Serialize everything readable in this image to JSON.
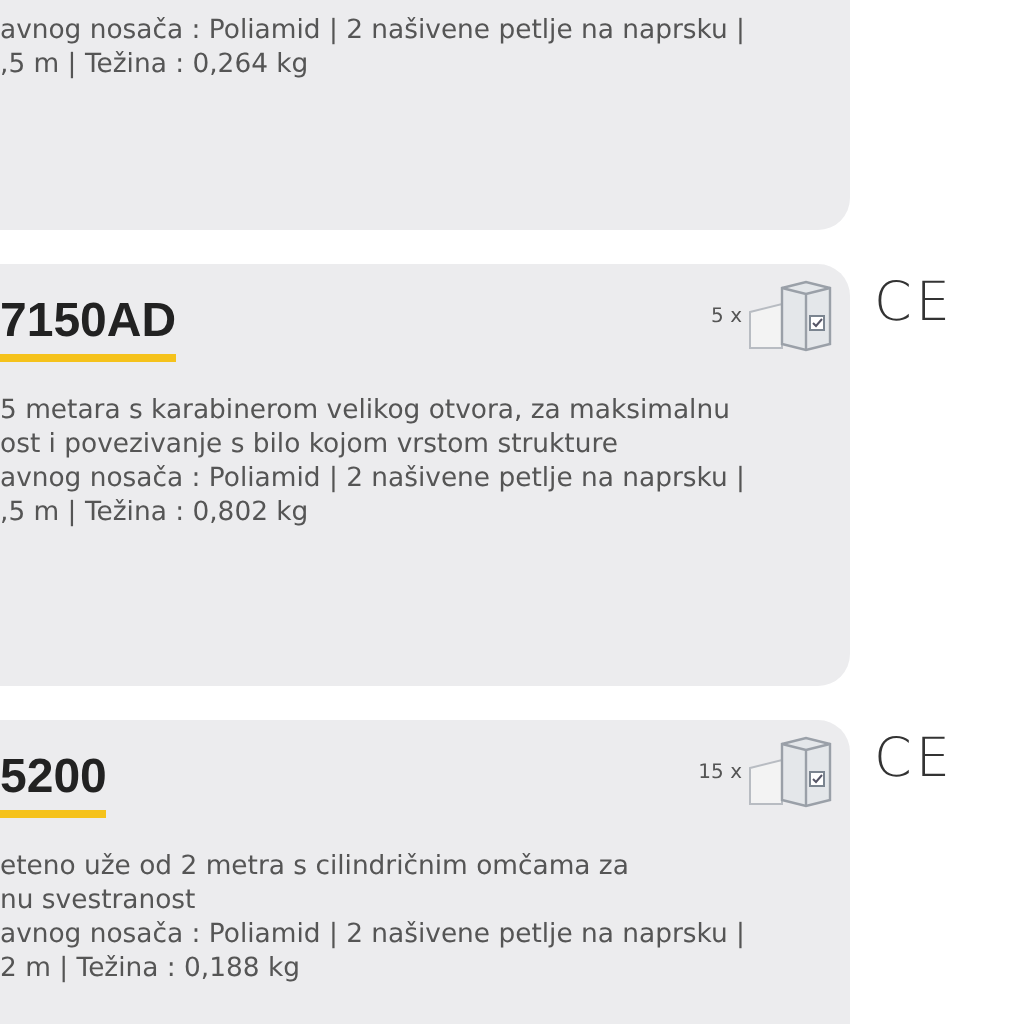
{
  "products": [
    {
      "description": [
        "avnog nosača : Poliamid | 2 našivene petlje na naprsku |",
        ",5 m | Težina : 0,264 kg"
      ]
    },
    {
      "code": "7150AD",
      "pack_count": "5 x",
      "certification": "CE",
      "description": [
        "5 metara s karabinerom velikog otvora, za maksimalnu",
        "ost i povezivanje s bilo kojom vrstom strukture",
        "avnog nosača : Poliamid | 2 našivene petlje na naprsku |",
        ",5 m | Težina : 0,802 kg"
      ]
    },
    {
      "code": "5200",
      "pack_count": "15 x",
      "certification": "CE",
      "description": [
        "eteno uže od 2 metra s cilindričnim omčama za",
        "nu svestranost",
        "avnog nosača : Poliamid | 2 našivene petlje na naprsku |",
        "2 m | Težina : 0,188 kg"
      ]
    }
  ]
}
